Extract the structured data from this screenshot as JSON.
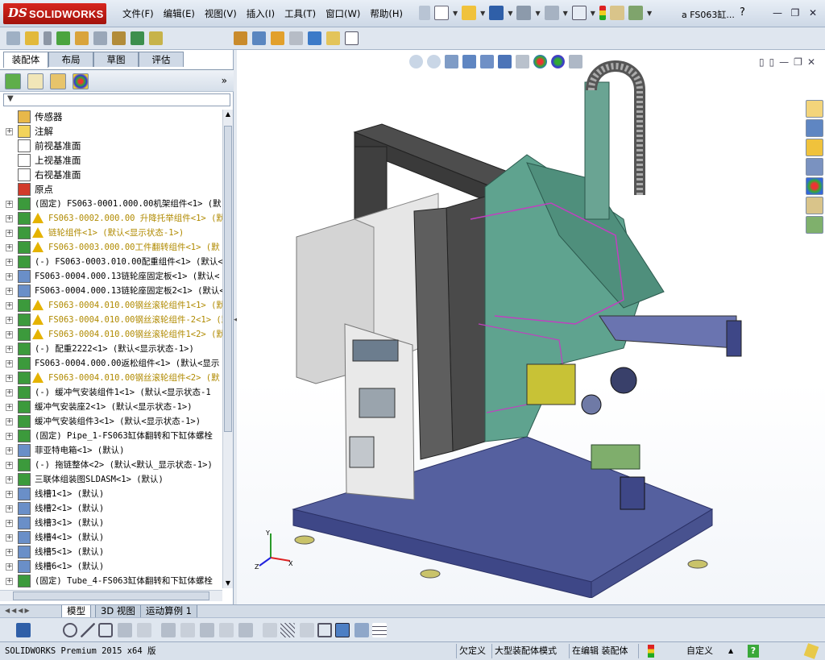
{
  "app": {
    "logo_ds": "DS",
    "logo_name": "SOLIDWORKS",
    "document_title": "a FS063缸...",
    "help_symbol": "?"
  },
  "menu": [
    "文件(F)",
    "编辑(E)",
    "视图(V)",
    "插入(I)",
    "工具(T)",
    "窗口(W)",
    "帮助(H)"
  ],
  "feature_manager": {
    "tabs": [
      "装配体",
      "布局",
      "草图",
      "评估"
    ],
    "active_tab": "装配体",
    "more_label": "»",
    "tree": [
      {
        "label": "传感器",
        "type": "plain",
        "expand": false,
        "icon": "sensor-icon",
        "color": "#e8b84a"
      },
      {
        "label": "注解",
        "type": "plain",
        "expand": true,
        "icon": "annotation-icon",
        "color": "#f2d35b"
      },
      {
        "label": "前视基准面",
        "type": "plain",
        "expand": false,
        "icon": "plane-icon",
        "color": "#ffffff"
      },
      {
        "label": "上视基准面",
        "type": "plain",
        "expand": false,
        "icon": "plane-icon",
        "color": "#ffffff"
      },
      {
        "label": "右视基准面",
        "type": "plain",
        "expand": false,
        "icon": "plane-icon",
        "color": "#ffffff"
      },
      {
        "label": "原点",
        "type": "plain",
        "expand": false,
        "icon": "origin-icon",
        "color": "#d23a2a"
      },
      {
        "label": "(固定) FS063-0001.000.00机架组件<1> (默",
        "type": "normal",
        "expand": true,
        "icon": "subassembly-icon",
        "color": "#3c9a3c"
      },
      {
        "label": "FS063-0002.000.00 升降托举组件<1> (默",
        "type": "warning",
        "expand": true,
        "icon": "subassembly-icon",
        "color": "#3c9a3c"
      },
      {
        "label": "链轮组件<1> (默认<显示状态-1>)",
        "type": "warning",
        "expand": true,
        "icon": "subassembly-icon",
        "color": "#3c9a3c"
      },
      {
        "label": "FS063-0003.000.00工件翻转组件<1> (默",
        "type": "warning",
        "expand": true,
        "icon": "subassembly-icon",
        "color": "#3c9a3c"
      },
      {
        "label": "(-) FS063-0003.010.00配重组件<1> (默认<",
        "type": "normal",
        "expand": true,
        "icon": "subassembly-icon",
        "color": "#3c9a3c"
      },
      {
        "label": "FS063-0004.000.13链轮座固定板<1> (默认<",
        "type": "normal",
        "expand": true,
        "icon": "part-icon",
        "color": "#6a8fc8"
      },
      {
        "label": "FS063-0004.000.13链轮座固定板2<1> (默认<",
        "type": "normal",
        "expand": true,
        "icon": "part-icon",
        "color": "#6a8fc8"
      },
      {
        "label": "FS063-0004.010.00钢丝滚轮组件1<1> (默",
        "type": "warning",
        "expand": true,
        "icon": "subassembly-icon",
        "color": "#3c9a3c"
      },
      {
        "label": "FS063-0004.010.00钢丝滚轮组件-2<1> (默",
        "type": "warning",
        "expand": true,
        "icon": "subassembly-icon",
        "color": "#3c9a3c"
      },
      {
        "label": "FS063-0004.010.00钢丝滚轮组件1<2> (默",
        "type": "warning",
        "expand": true,
        "icon": "subassembly-icon",
        "color": "#3c9a3c"
      },
      {
        "label": "(-) 配重2222<1> (默认<显示状态-1>)",
        "type": "normal",
        "expand": true,
        "icon": "subassembly-icon",
        "color": "#3c9a3c"
      },
      {
        "label": "FS063-0004.000.00返松组件<1> (默认<显示",
        "type": "normal",
        "expand": true,
        "icon": "subassembly-icon",
        "color": "#3c9a3c"
      },
      {
        "label": "FS063-0004.010.00钢丝滚轮组件<2> (默",
        "type": "warning",
        "expand": true,
        "icon": "subassembly-icon",
        "color": "#3c9a3c"
      },
      {
        "label": "(-) 缓冲气安装组件1<1> (默认<显示状态-1",
        "type": "normal",
        "expand": true,
        "icon": "subassembly-icon",
        "color": "#3c9a3c"
      },
      {
        "label": "缓冲气安装座2<1> (默认<显示状态-1>)",
        "type": "normal",
        "expand": true,
        "icon": "subassembly-icon",
        "color": "#3c9a3c"
      },
      {
        "label": "缓冲气安装组件3<1> (默认<显示状态-1>)",
        "type": "normal",
        "expand": true,
        "icon": "subassembly-icon",
        "color": "#3c9a3c"
      },
      {
        "label": "(固定) Pipe_1-FS063缸体翻转和下缸体螺栓",
        "type": "normal",
        "expand": true,
        "icon": "subassembly-icon",
        "color": "#3c9a3c"
      },
      {
        "label": "菲亚特电箱<1> (默认)",
        "type": "normal",
        "expand": true,
        "icon": "part-icon",
        "color": "#6a8fc8"
      },
      {
        "label": "(-) 拖链整体<2> (默认<默认_显示状态-1>)",
        "type": "normal",
        "expand": true,
        "icon": "subassembly-icon",
        "color": "#3c9a3c"
      },
      {
        "label": "三联体组装图SLDASM<1> (默认)",
        "type": "normal",
        "expand": true,
        "icon": "subassembly-icon",
        "color": "#3c9a3c"
      },
      {
        "label": "线槽1<1> (默认)",
        "type": "normal",
        "expand": true,
        "icon": "part-icon",
        "color": "#6a8fc8"
      },
      {
        "label": "线槽2<1> (默认)",
        "type": "normal",
        "expand": true,
        "icon": "part-icon",
        "color": "#6a8fc8"
      },
      {
        "label": "线槽3<1> (默认)",
        "type": "normal",
        "expand": true,
        "icon": "part-icon",
        "color": "#6a8fc8"
      },
      {
        "label": "线槽4<1> (默认)",
        "type": "normal",
        "expand": true,
        "icon": "part-icon",
        "color": "#6a8fc8"
      },
      {
        "label": "线槽5<1> (默认)",
        "type": "normal",
        "expand": true,
        "icon": "part-icon",
        "color": "#6a8fc8"
      },
      {
        "label": "线槽6<1> (默认)",
        "type": "normal",
        "expand": true,
        "icon": "part-icon",
        "color": "#6a8fc8"
      },
      {
        "label": "(固定) Tube_4-FS063缸体翻转和下缸体螺栓",
        "type": "normal",
        "expand": true,
        "icon": "subassembly-icon",
        "color": "#3c9a3c"
      }
    ]
  },
  "bottom_tabs": [
    "模型",
    "3D 视图",
    "运动算例 1"
  ],
  "active_bottom_tab": "模型",
  "triad": {
    "x": "X",
    "y": "Y",
    "z": "Z"
  },
  "status": {
    "product": "SOLIDWORKS Premium 2015 x64 版",
    "definition": "欠定义",
    "mode": "大型装配体模式",
    "editing": "在编辑 装配体",
    "custom": "自定义",
    "up_arrow": "▲",
    "help": "?"
  },
  "colors": {
    "base_frame": "#4e5a9c",
    "teal_body": "#5a9a8a",
    "dark_panel": "#4a4a4a",
    "grey_cabinet": "#cfcfcf",
    "highlight": "#c040c0"
  }
}
